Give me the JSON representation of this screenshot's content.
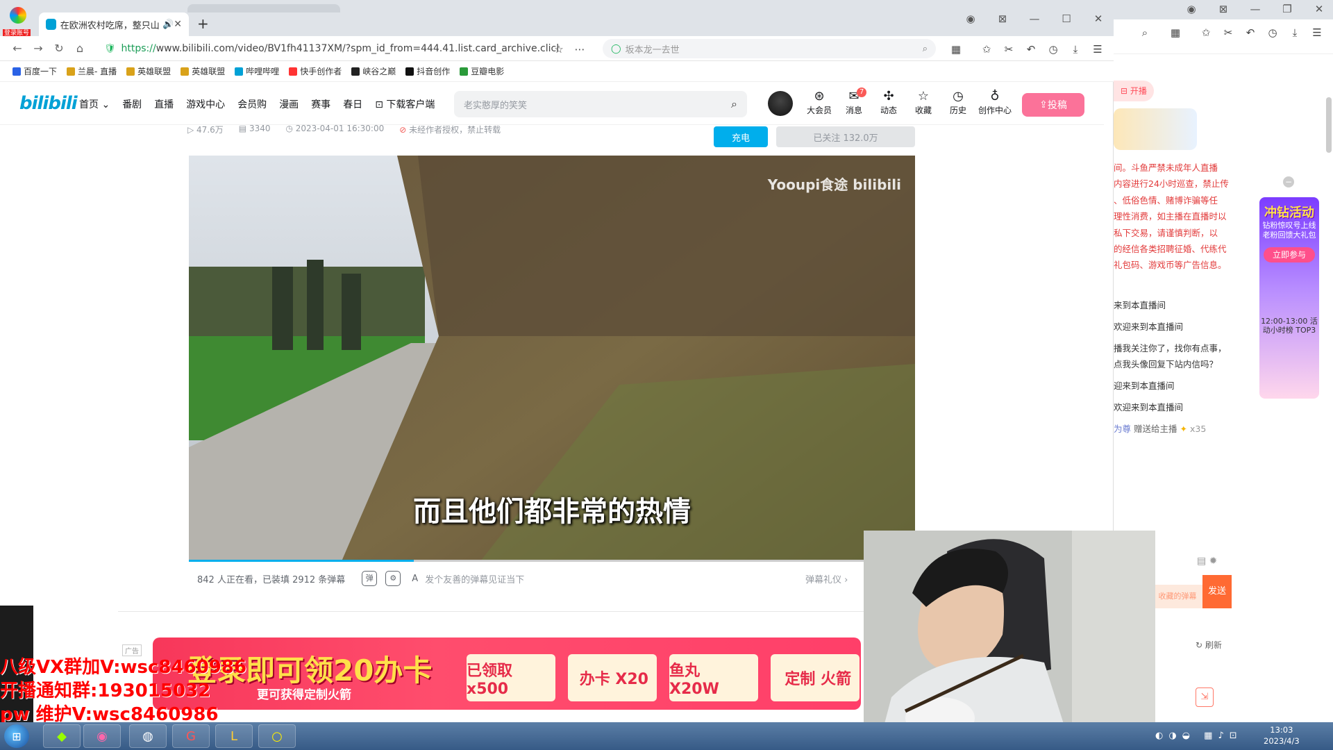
{
  "browser": {
    "login_badge": "登录账号",
    "tab_active": "在欧洲农村吃席，整只山羊",
    "new_tab": "+",
    "url_https": "https://",
    "url_rest": "www.bilibili.com/video/BV1fh41137XM/?spm_id_from=444.41.list.card_archive.clicl",
    "search_box": "坂本龙一去世",
    "bookmarks": [
      "百度一下",
      "兰晨- 直播",
      "英雄联盟",
      "英雄联盟",
      "哔哩哔哩",
      "快手创作者",
      "峡谷之巅",
      "抖音创作",
      "豆瓣电影"
    ]
  },
  "bili": {
    "logo": "bilibili",
    "nav": [
      "首页 ⌄",
      "番剧",
      "直播",
      "游戏中心",
      "会员购",
      "漫画",
      "赛事",
      "春日",
      "下载客户端"
    ],
    "search_placeholder": "老实憨厚的笑笑",
    "header_icons": [
      {
        "label": "大会员",
        "icon": "vip-icon",
        "glyph": "⊛"
      },
      {
        "label": "消息",
        "icon": "message-icon",
        "glyph": "✉",
        "badge": "7"
      },
      {
        "label": "动态",
        "icon": "dynamic-icon",
        "glyph": "✣"
      },
      {
        "label": "收藏",
        "icon": "star-icon",
        "glyph": "☆"
      },
      {
        "label": "历史",
        "icon": "history-icon",
        "glyph": "◷"
      },
      {
        "label": "创作中心",
        "icon": "bulb-icon",
        "glyph": "♁"
      }
    ],
    "upload": "投稿",
    "meta": {
      "plays": "47.6万",
      "danmaku": "3340",
      "date": "2023-04-01 16:30:00",
      "notice": "未经作者授权，禁止转载"
    },
    "charge": "充电",
    "followed": "已关注 132.0万",
    "watermark": "Yooupi食途 bilibili",
    "subtitle": "而且他们都非常的热情",
    "progress": 0.31,
    "watching": "842 人正在看，已装填 2912 条弹幕",
    "danmaku_placeholder": "发个友善的弹幕见证当下",
    "danmaku_etiquette": "弹幕礼仪 ›"
  },
  "ad": {
    "tag": "广告",
    "headline": "登录即可领20办卡",
    "sub": "更可获得定制火箭",
    "cards": [
      "已领取 x500",
      "办卡 X20",
      "鱼丸 X20W",
      "定制 火箭"
    ]
  },
  "overlay": {
    "lines": [
      "八级VX群加V:wsc8460986",
      "开播通知群:193015032",
      "pw 维护V:wsc8460986"
    ]
  },
  "live": {
    "open": "开播",
    "rules": [
      "间。斗鱼严禁未成年人直播",
      "内容进行24小时巡查，禁止传",
      "、低俗色情、赌博诈骗等任",
      "理性消费，如主播在直播时以",
      "私下交易，请谨慎判断，以",
      "的经信各类招聘征婚、代练代",
      "礼包码、游戏币等广告信息。"
    ],
    "messages": [
      "来到本直播间",
      "欢迎来到本直播间",
      "播我关注你了，找你有点事，",
      "点我头像回复下站内信吗？",
      "迎来到本直播间",
      "欢迎来到本直播间"
    ],
    "gift": {
      "user": "为尊",
      "text": "赠送给主播",
      "count": "x35"
    },
    "send": "发送",
    "input": "收藏的弹幕",
    "refresh": "刷新",
    "event": {
      "title": "冲钻活动",
      "sub": "钻粉惊叹号上线 老粉回馈大礼包",
      "join": "立即参与",
      "time": "12:00-13:00 活动小时榜 TOP3"
    }
  },
  "taskbar": {
    "time": "13:03",
    "date": "2023/4/3"
  }
}
